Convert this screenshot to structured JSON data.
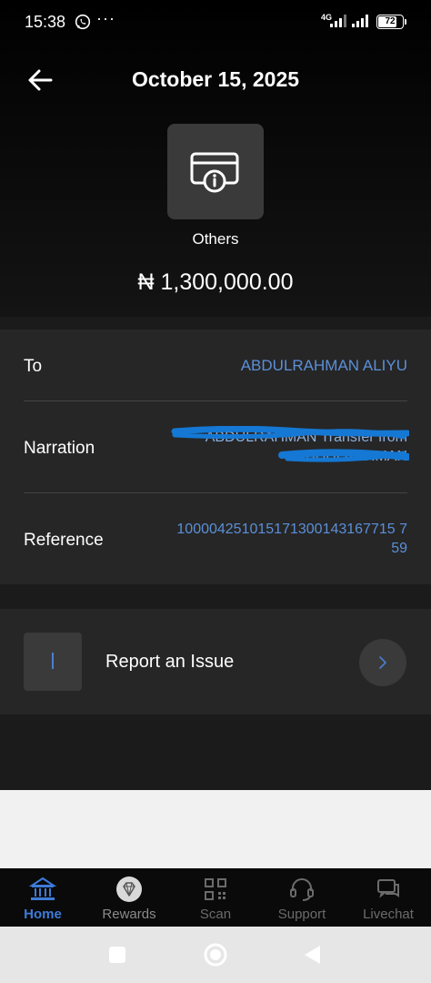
{
  "status_bar": {
    "time": "15:38",
    "more": "···",
    "network": "4G",
    "battery": "72",
    "battery_fraction": 0.72
  },
  "header": {
    "title": "October 15, 2025",
    "category_icon": "card-info-icon",
    "category": "Others",
    "amount": "₦ 1,300,000.00"
  },
  "details": {
    "to_label": "To",
    "to_value": "ABDULRAHMAN ALIYU",
    "narration_label": "Narration",
    "narration_value_line1": "ABDULRAHMAN Transfer from",
    "narration_value_line2": "ABDULRAHMAN",
    "reference_label": "Reference",
    "reference_line1": "100004251015171300143167715 7",
    "reference_line2": "59"
  },
  "report": {
    "label": "Report an Issue"
  },
  "bottom_nav": {
    "items": [
      {
        "label": "Home",
        "icon": "bank-icon"
      },
      {
        "label": "Rewards",
        "icon": "diamond-icon"
      },
      {
        "label": "Scan",
        "icon": "qr-code-icon"
      },
      {
        "label": "Support",
        "icon": "headset-icon"
      },
      {
        "label": "Livechat",
        "icon": "chat-bubble-icon"
      }
    ]
  },
  "colors": {
    "accent": "#3d7bd9",
    "link_text": "#5b8fd8",
    "card": "#262626",
    "background": "#1b1b1b"
  }
}
